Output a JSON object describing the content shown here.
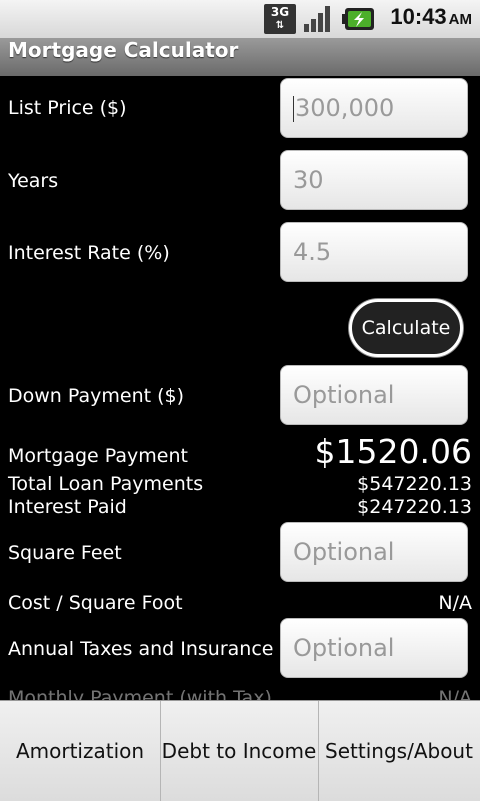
{
  "status_bar": {
    "network": "3G",
    "time": "10:43",
    "ampm": "AM",
    "icons": [
      "3g-data-icon",
      "signal-strength-icon",
      "battery-charging-icon"
    ]
  },
  "app": {
    "title": "Mortgage Calculator"
  },
  "form": {
    "list_price": {
      "label": "List Price ($)",
      "value": "300,000"
    },
    "years": {
      "label": "Years",
      "value": "30"
    },
    "interest_rate": {
      "label": "Interest Rate (%)",
      "value": "4.5"
    },
    "calculate_label": "Calculate",
    "down_payment": {
      "label": "Down Payment ($)",
      "placeholder": "Optional"
    },
    "square_feet": {
      "label": "Square Feet",
      "placeholder": "Optional"
    },
    "taxes_insurance": {
      "label": "Annual Taxes and Insurance",
      "placeholder": "Optional"
    }
  },
  "results": {
    "mortgage_payment": {
      "label": "Mortgage Payment",
      "value": "$1520.06"
    },
    "total_loan_payments": {
      "label": "Total Loan Payments",
      "value": "$547220.13"
    },
    "interest_paid": {
      "label": "Interest Paid",
      "value": "$247220.13"
    },
    "cost_per_sqft": {
      "label": "Cost / Square Foot",
      "value": "N/A"
    },
    "monthly_with_tax": {
      "label": "Monthly Payment (with Tax)",
      "value": "N/A"
    }
  },
  "menu": {
    "items": [
      "Amortization",
      "Debt to Income",
      "Settings/About"
    ]
  },
  "colors": {
    "background": "#000000",
    "field": "#ffffff",
    "menu": "#e8e8e8"
  }
}
